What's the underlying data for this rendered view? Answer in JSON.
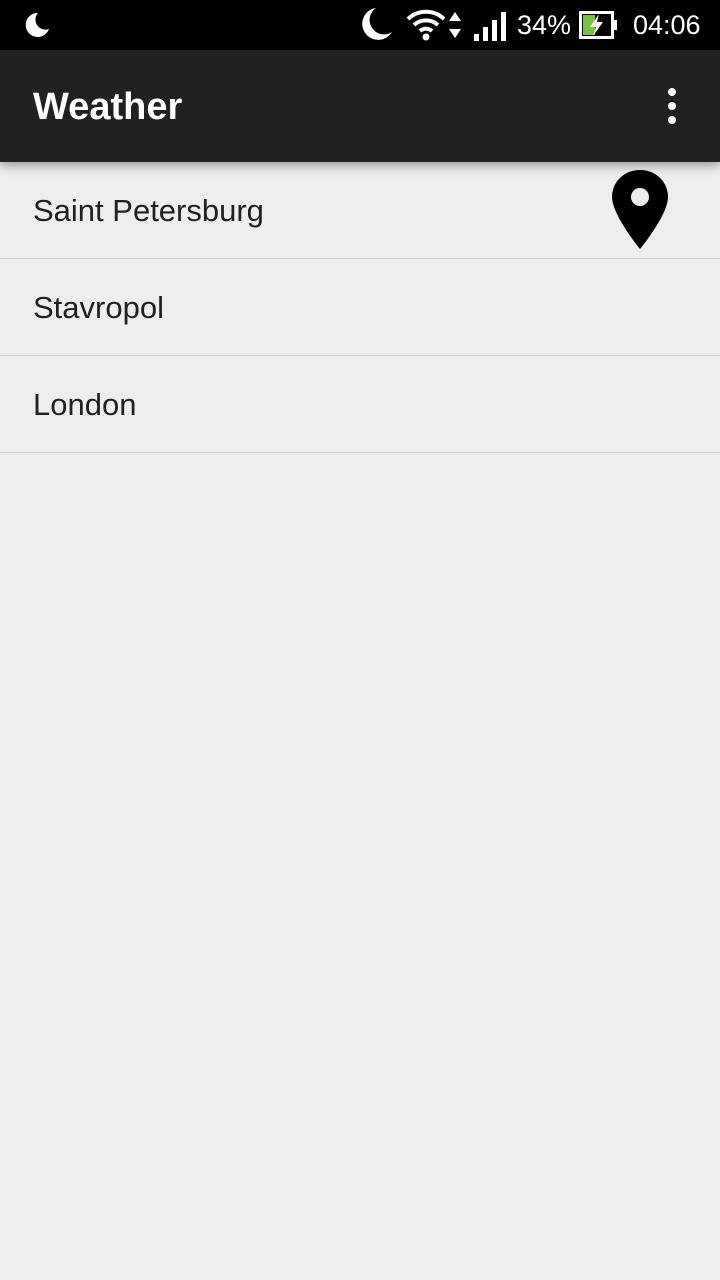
{
  "status_bar": {
    "battery_percent": "34%",
    "time": "04:06",
    "icons": [
      "moon-icon",
      "do-not-disturb-moon-icon",
      "wifi-icon",
      "data-arrows-icon",
      "cellular-signal-icon",
      "battery-charging-icon"
    ],
    "battery_accent": "#76c442"
  },
  "app_bar": {
    "title": "Weather",
    "overflow_icon": "more-vert-icon"
  },
  "cities": [
    {
      "name": "Saint Petersburg",
      "current_location_icon": "location-pin-icon"
    },
    {
      "name": "Stavropol"
    },
    {
      "name": "London"
    }
  ],
  "colors": {
    "status_bar": "#000000",
    "app_bar": "#212121",
    "background": "#eeeeee",
    "text": "#212121",
    "divider": "#cfcfcf"
  }
}
